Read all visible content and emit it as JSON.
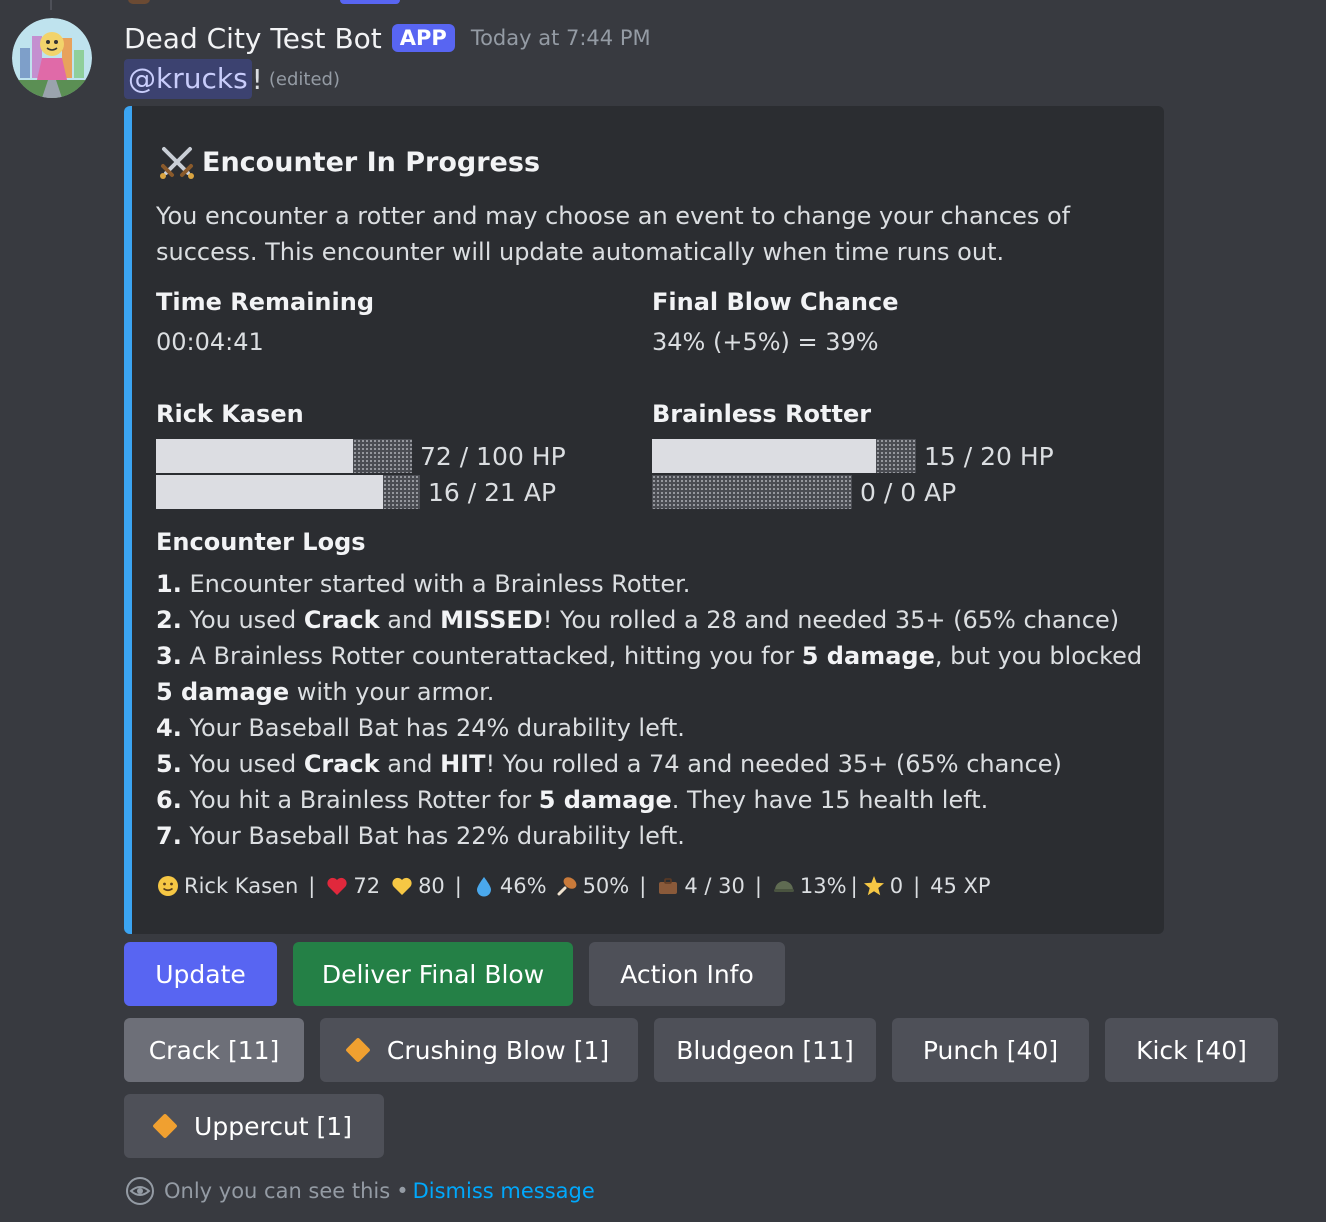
{
  "message": {
    "author": "Dead City Test Bot",
    "badge": "APP",
    "timestamp": "Today at 7:44 PM",
    "mention": "@krucks",
    "mention_suffix": "!",
    "edited": "(edited)"
  },
  "embed": {
    "accent_color": "#3ba4f2",
    "title": "Encounter In Progress",
    "title_icon": "crossed-swords-icon",
    "description": "You encounter a rotter and may choose an event to change your chances of success. This encounter will update automatically when time runs out.",
    "fields": {
      "time_remaining": {
        "name": "Time Remaining",
        "value": "00:04:41"
      },
      "final_blow": {
        "name": "Final Blow Chance",
        "value": "34% (+5%) = 39%"
      }
    },
    "player": {
      "name": "Rick Kasen",
      "hp": {
        "text": "72 / 100 HP",
        "fraction": 0.77
      },
      "ap": {
        "text": "16 / 21 AP",
        "fraction": 0.86
      }
    },
    "enemy": {
      "name": "Brainless Rotter",
      "hp": {
        "text": "15 / 20 HP",
        "fraction": 0.85
      },
      "ap": {
        "text": "0 / 0 AP",
        "fraction": 0
      }
    },
    "logs": {
      "title": "Encounter Logs",
      "l1": {
        "num": "1.",
        "t1": "Encounter started with a Brainless Rotter."
      },
      "l2": {
        "num": "2.",
        "t1": "You used ",
        "b1": "Crack",
        "t2": " and ",
        "b2": "MISSED",
        "t3": "! You rolled a 28 and needed 35+ (65% chance)"
      },
      "l3": {
        "num": "3.",
        "t1": "A Brainless Rotter counterattacked, hitting you for ",
        "b1": "5 damage",
        "t2": ", but you blocked"
      },
      "l3b": {
        "b1": "5 damage",
        "t1": " with your armor."
      },
      "l4": {
        "num": "4.",
        "t1": "Your Baseball Bat has 24% durability left."
      },
      "l5": {
        "num": "5.",
        "t1": "You used ",
        "b1": "Crack",
        "t2": " and ",
        "b2": "HIT",
        "t3": "! You rolled a 74 and needed 35+ (65% chance)"
      },
      "l6": {
        "num": "6.",
        "t1": "You hit a Brainless Rotter for ",
        "b1": "5 damage",
        "t2": ". They have 15 health left."
      },
      "l7": {
        "num": "7.",
        "t1": "Your Baseball Bat has 22% durability left."
      }
    },
    "status": {
      "name": "Rick Kasen",
      "name_icon": "smiley-icon",
      "health": "72",
      "health_icon": "red-heart-icon",
      "stamina": "80",
      "stamina_icon": "yellow-heart-icon",
      "water": "46%",
      "water_icon": "droplet-icon",
      "food": "50%",
      "food_icon": "drumstick-icon",
      "inventory": "4 / 30",
      "inventory_icon": "briefcase-icon",
      "armor": "13%",
      "armor_icon": "helmet-icon",
      "stars": "0",
      "stars_icon": "star-icon",
      "xp": "45 XP",
      "separator": "|"
    }
  },
  "buttons": {
    "update": "Update",
    "final_blow": "Deliver Final Blow",
    "action_info": "Action Info",
    "crack": "Crack [11]",
    "crushing_blow": "Crushing Blow [1]",
    "bludgeon": "Bludgeon [11]",
    "punch": "Punch [40]",
    "kick": "Kick [40]",
    "uppercut": "Uppercut [1]"
  },
  "footer": {
    "visibility": "Only you can see this",
    "dot": "•",
    "dismiss": "Dismiss message"
  }
}
